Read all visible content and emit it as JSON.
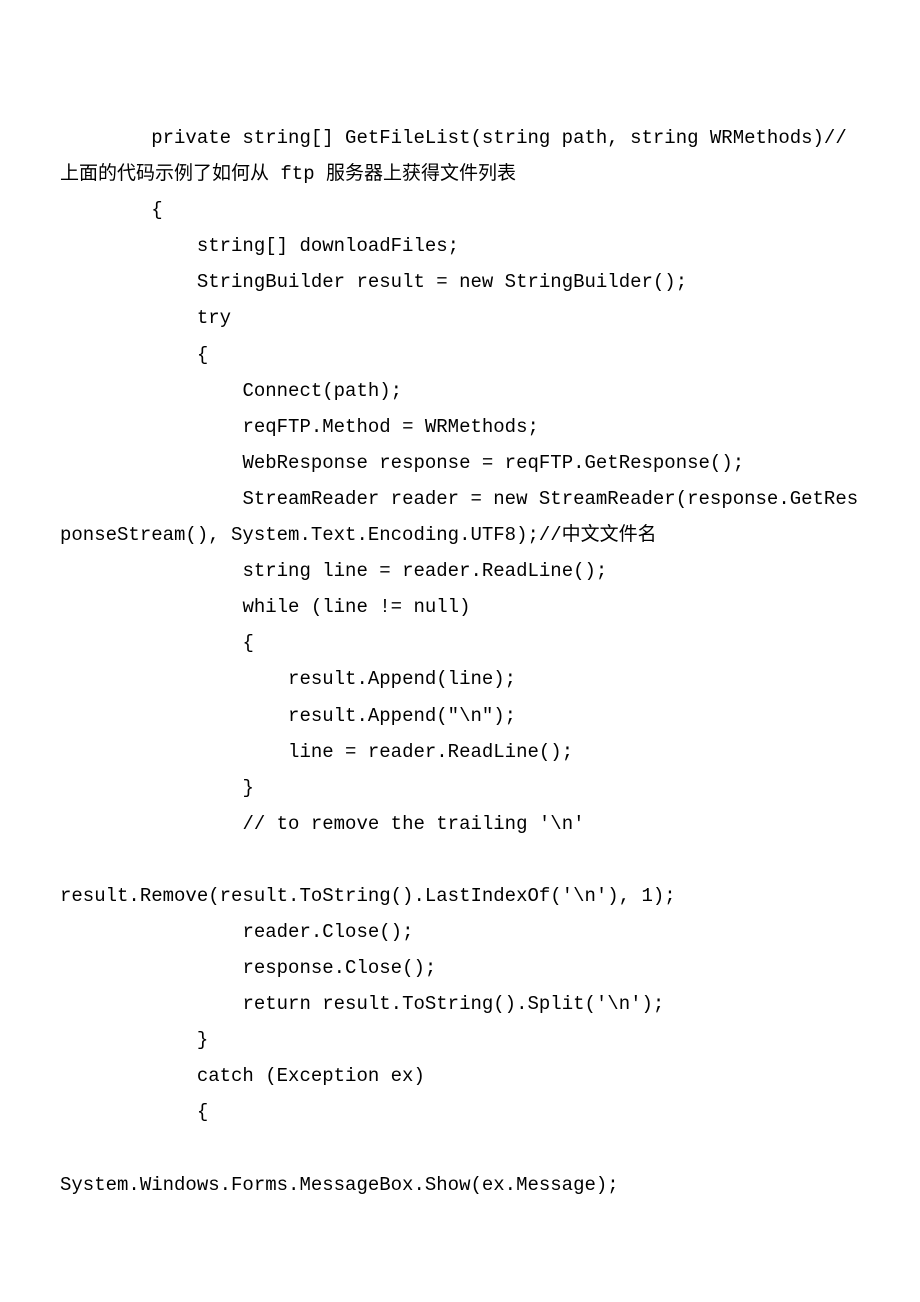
{
  "lines": [
    "        private string[] GetFileList(string path, string WRMethods)//上面的代码示例了如何从 ftp 服务器上获得文件列表",
    "        {",
    "            string[] downloadFiles;",
    "            StringBuilder result = new StringBuilder();",
    "            try",
    "            {",
    "                Connect(path);",
    "                reqFTP.Method = WRMethods;",
    "                WebResponse response = reqFTP.GetResponse();",
    "                StreamReader reader = new StreamReader(response.GetResponseStream(), System.Text.Encoding.UTF8);//中文文件名",
    "                string line = reader.ReadLine();",
    "                while (line != null)",
    "                {",
    "                    result.Append(line);",
    "                    result.Append(\"\\n\");",
    "                    line = reader.ReadLine();",
    "                }",
    "                // to remove the trailing '\\n'",
    "",
    "result.Remove(result.ToString().LastIndexOf('\\n'), 1);",
    "                reader.Close();",
    "                response.Close();",
    "                return result.ToString().Split('\\n');",
    "            }",
    "            catch (Exception ex)",
    "            {",
    "",
    "System.Windows.Forms.MessageBox.Show(ex.Message);"
  ]
}
